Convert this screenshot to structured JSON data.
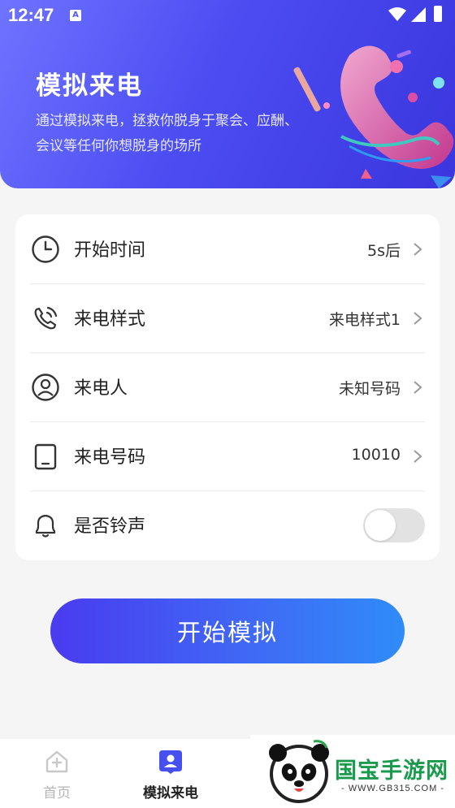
{
  "status_bar": {
    "time": "12:47",
    "notification_icon": "A"
  },
  "hero": {
    "title": "模拟来电",
    "description": "通过模拟来电，拯救你脱身于聚会、应酬、会议等任何你想脱身的场所"
  },
  "settings": {
    "start_time": {
      "label": "开始时间",
      "value": "5s后",
      "icon": "clock-icon"
    },
    "call_style": {
      "label": "来电样式",
      "value": "来电样式1",
      "icon": "phone-call-icon"
    },
    "caller": {
      "label": "来电人",
      "value": "未知号码",
      "icon": "user-icon"
    },
    "caller_number": {
      "label": "来电号码",
      "value": "10010",
      "icon": "tablet-icon"
    },
    "ringtone": {
      "label": "是否铃声",
      "enabled": false,
      "icon": "bell-icon"
    }
  },
  "start_button": {
    "label": "开始模拟"
  },
  "bottom_nav": {
    "items": [
      {
        "label": "首页",
        "icon": "home-icon",
        "active": false
      },
      {
        "label": "模拟来电",
        "icon": "contact-icon",
        "active": true
      }
    ]
  },
  "watermark": {
    "text": "国宝手游网",
    "url": "- WWW.GB315.COM -"
  },
  "colors": {
    "primary": "#4b4df2",
    "accent": "#2f8cf8",
    "text": "#222222",
    "muted": "#b5b5b5"
  }
}
